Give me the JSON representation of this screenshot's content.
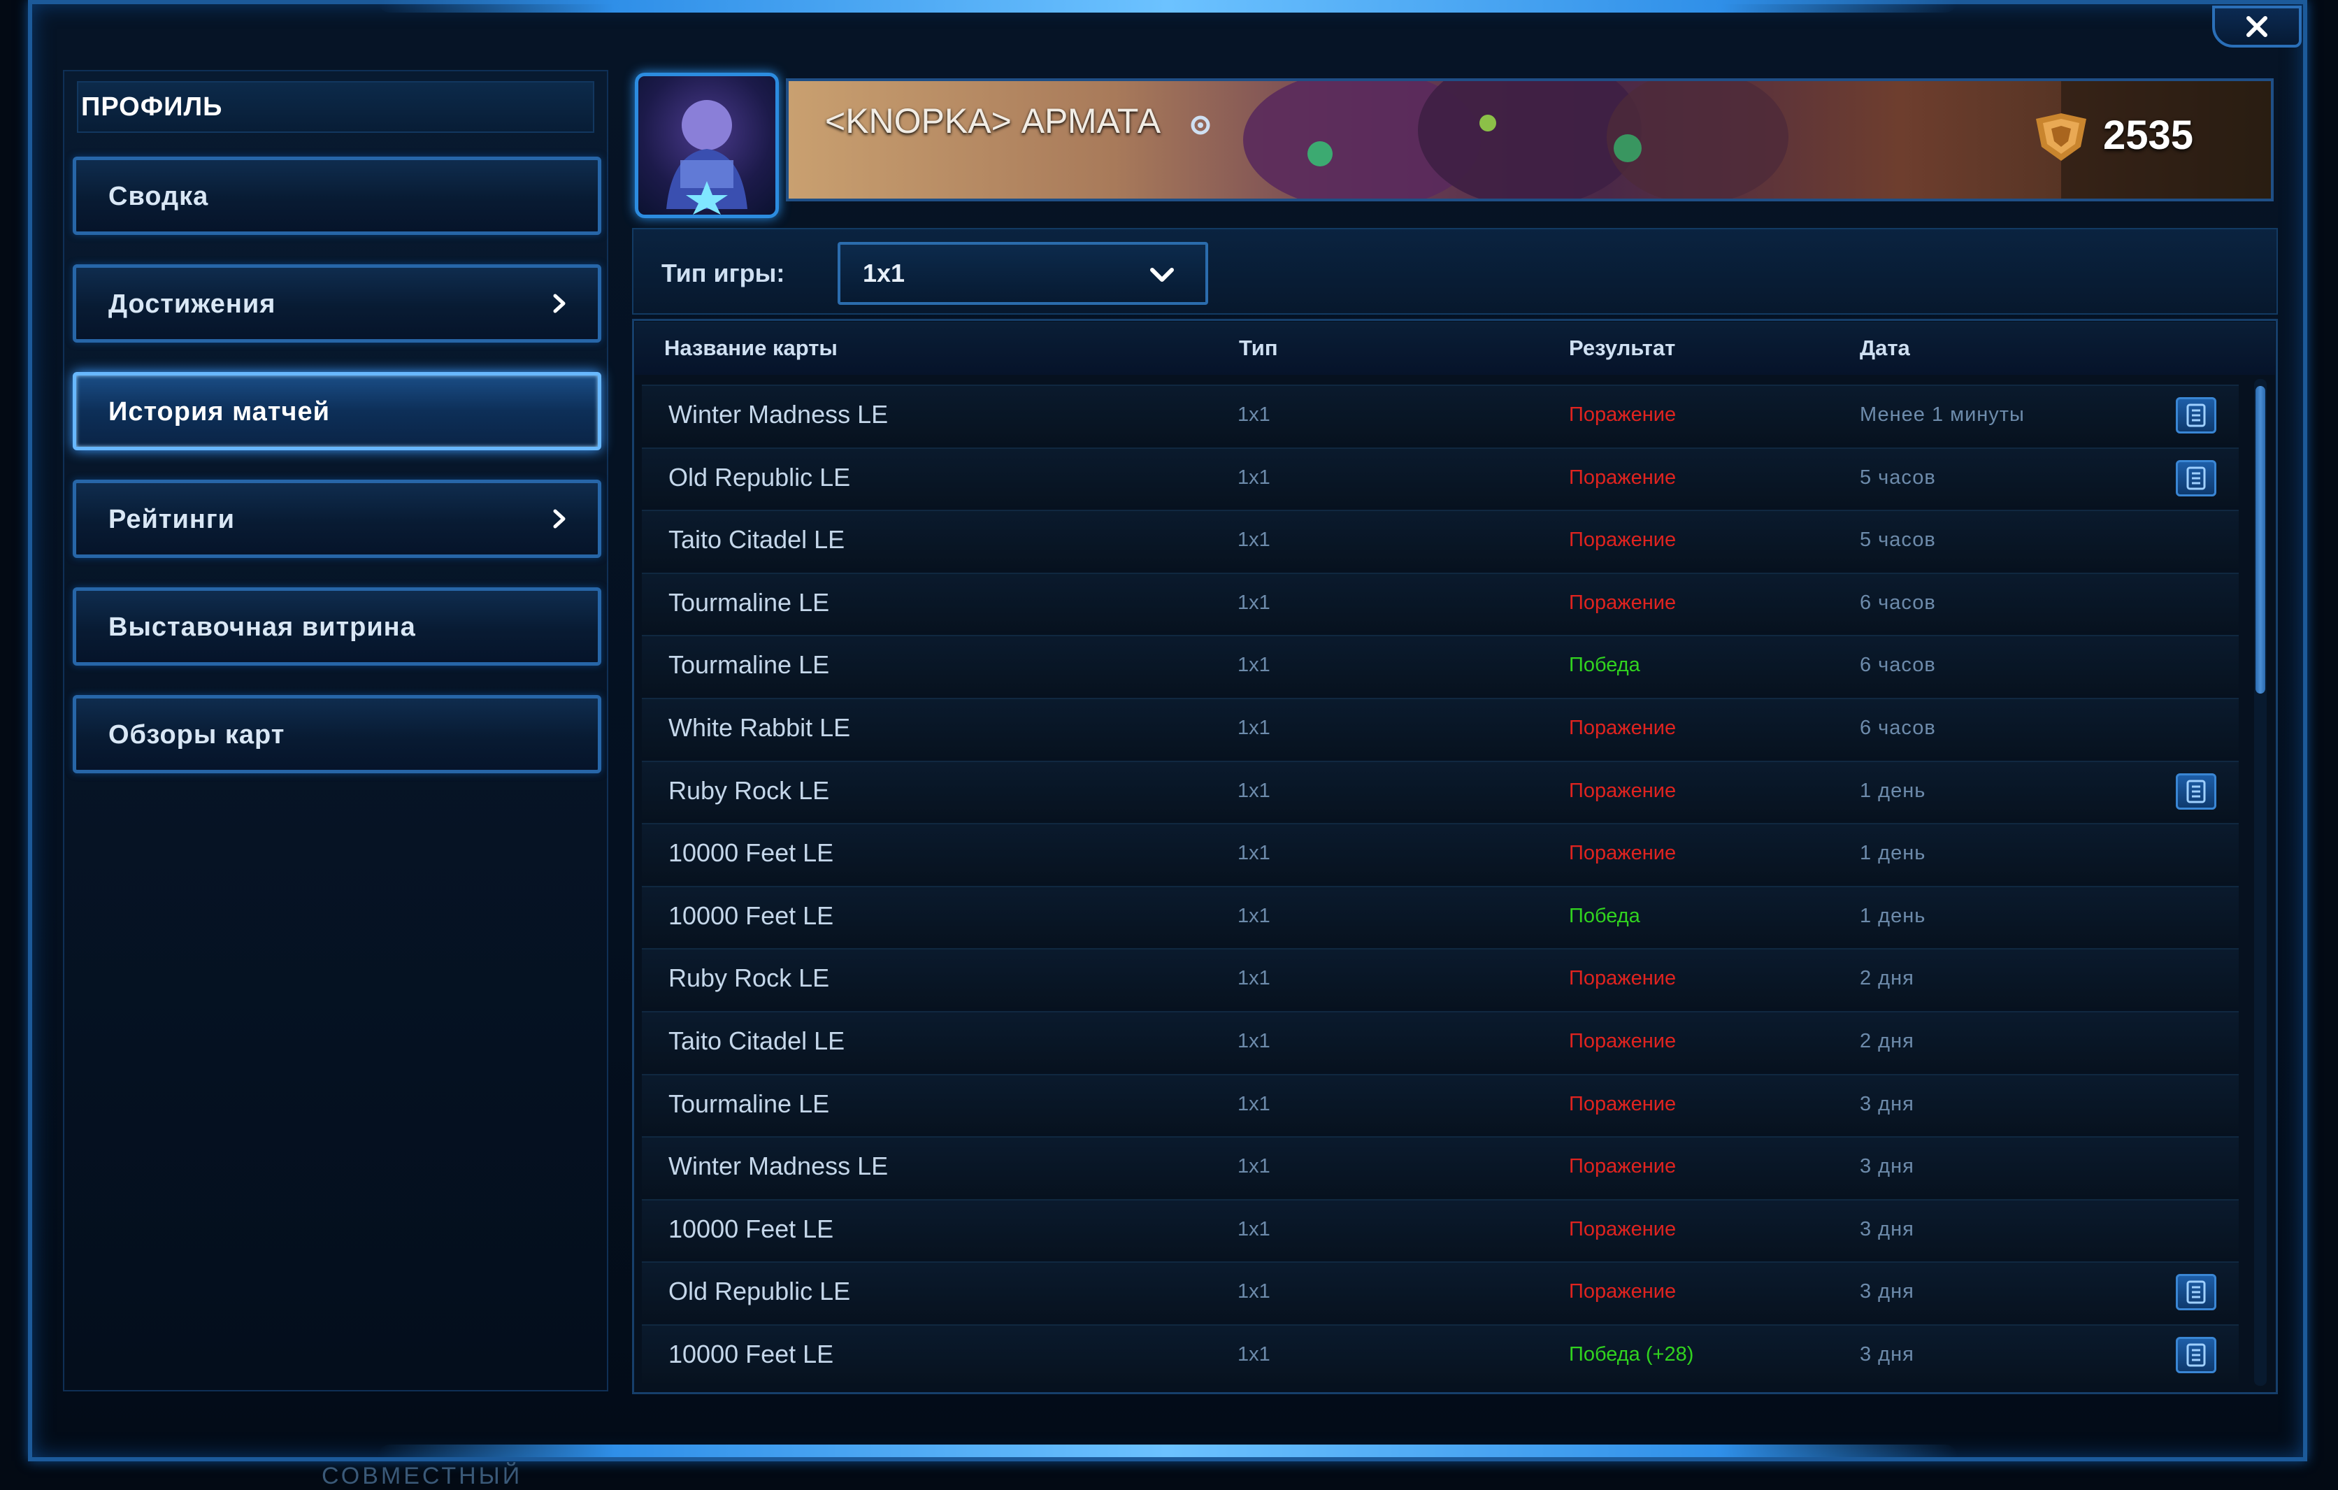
{
  "window": {
    "close_glyph": "×"
  },
  "sidebar": {
    "title": "ПРОФИЛЬ",
    "items": [
      {
        "label": "Сводка",
        "has_arrow": false,
        "active": false
      },
      {
        "label": "Достижения",
        "has_arrow": true,
        "active": false
      },
      {
        "label": "История матчей",
        "has_arrow": false,
        "active": true
      },
      {
        "label": "Рейтинги",
        "has_arrow": true,
        "active": false
      },
      {
        "label": "Выставочная витрина",
        "has_arrow": false,
        "active": false
      },
      {
        "label": "Обзоры карт",
        "has_arrow": false,
        "active": false
      }
    ]
  },
  "header": {
    "player_name": "<KNOPKA> АРМАТА",
    "mmr": "2535"
  },
  "filter": {
    "label": "Тип игры:",
    "value": "1x1"
  },
  "table": {
    "columns": [
      "Название карты",
      "Тип",
      "Результат",
      "Дата"
    ],
    "rows": [
      {
        "map": "Winter Madness LE",
        "type": "1x1",
        "result": "Поражение",
        "date": "Менее 1 минуты",
        "replay": true
      },
      {
        "map": "Old Republic LE",
        "type": "1x1",
        "result": "Поражение",
        "date": "5 часов",
        "replay": true
      },
      {
        "map": "Taito Citadel LE",
        "type": "1x1",
        "result": "Поражение",
        "date": "5 часов",
        "replay": false
      },
      {
        "map": "Tourmaline LE",
        "type": "1x1",
        "result": "Поражение",
        "date": "6 часов",
        "replay": false
      },
      {
        "map": "Tourmaline LE",
        "type": "1x1",
        "result": "Победа",
        "date": "6 часов",
        "replay": false
      },
      {
        "map": "White Rabbit LE",
        "type": "1x1",
        "result": "Поражение",
        "date": "6 часов",
        "replay": false
      },
      {
        "map": "Ruby Rock LE",
        "type": "1x1",
        "result": "Поражение",
        "date": "1 день",
        "replay": true
      },
      {
        "map": "10000 Feet LE",
        "type": "1x1",
        "result": "Поражение",
        "date": "1 день",
        "replay": false
      },
      {
        "map": "10000 Feet LE",
        "type": "1x1",
        "result": "Победа",
        "date": "1 день",
        "replay": false
      },
      {
        "map": "Ruby Rock LE",
        "type": "1x1",
        "result": "Поражение",
        "date": "2 дня",
        "replay": false
      },
      {
        "map": "Taito Citadel LE",
        "type": "1x1",
        "result": "Поражение",
        "date": "2 дня",
        "replay": false
      },
      {
        "map": "Tourmaline LE",
        "type": "1x1",
        "result": "Поражение",
        "date": "3 дня",
        "replay": false
      },
      {
        "map": "Winter Madness LE",
        "type": "1x1",
        "result": "Поражение",
        "date": "3 дня",
        "replay": false
      },
      {
        "map": "10000 Feet LE",
        "type": "1x1",
        "result": "Поражение",
        "date": "3 дня",
        "replay": false
      },
      {
        "map": "Old Republic LE",
        "type": "1x1",
        "result": "Поражение",
        "date": "3 дня",
        "replay": true
      },
      {
        "map": "10000 Feet LE",
        "type": "1x1",
        "result": "Победа (+28)",
        "date": "3 дня",
        "replay": true
      }
    ]
  },
  "colors": {
    "loss": "#e0231f",
    "win": "#31d31f",
    "accent": "#2f8fe8"
  },
  "footer": {
    "text": "СОВМЕСТНЫЙ"
  }
}
